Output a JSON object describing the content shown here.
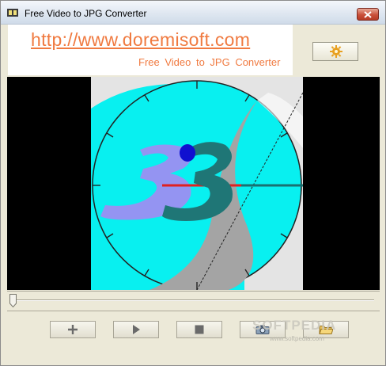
{
  "window": {
    "title": "Free Video to JPG Converter"
  },
  "banner": {
    "url": "http://www.doremisoft.com",
    "subtitle": "Free Video to JPG Converter"
  },
  "video": {
    "frame_number": "3"
  },
  "seek": {
    "position": 0.0
  },
  "toolbar": {
    "buttons": [
      {
        "name": "add",
        "icon": "plus-icon"
      },
      {
        "name": "play",
        "icon": "play-icon"
      },
      {
        "name": "stop",
        "icon": "stop-icon"
      },
      {
        "name": "snapshot",
        "icon": "camera-icon"
      },
      {
        "name": "open-folder",
        "icon": "folder-icon"
      }
    ]
  },
  "watermark": {
    "text": "SOFTPEDIA",
    "url": "www.softpedia.com"
  },
  "colors": {
    "accent": "#f07a40",
    "countdown_fill": "#00f0f0",
    "numeral_dark": "#1f7676",
    "numeral_light": "#9090f0",
    "sweep_line": "#e02020"
  }
}
